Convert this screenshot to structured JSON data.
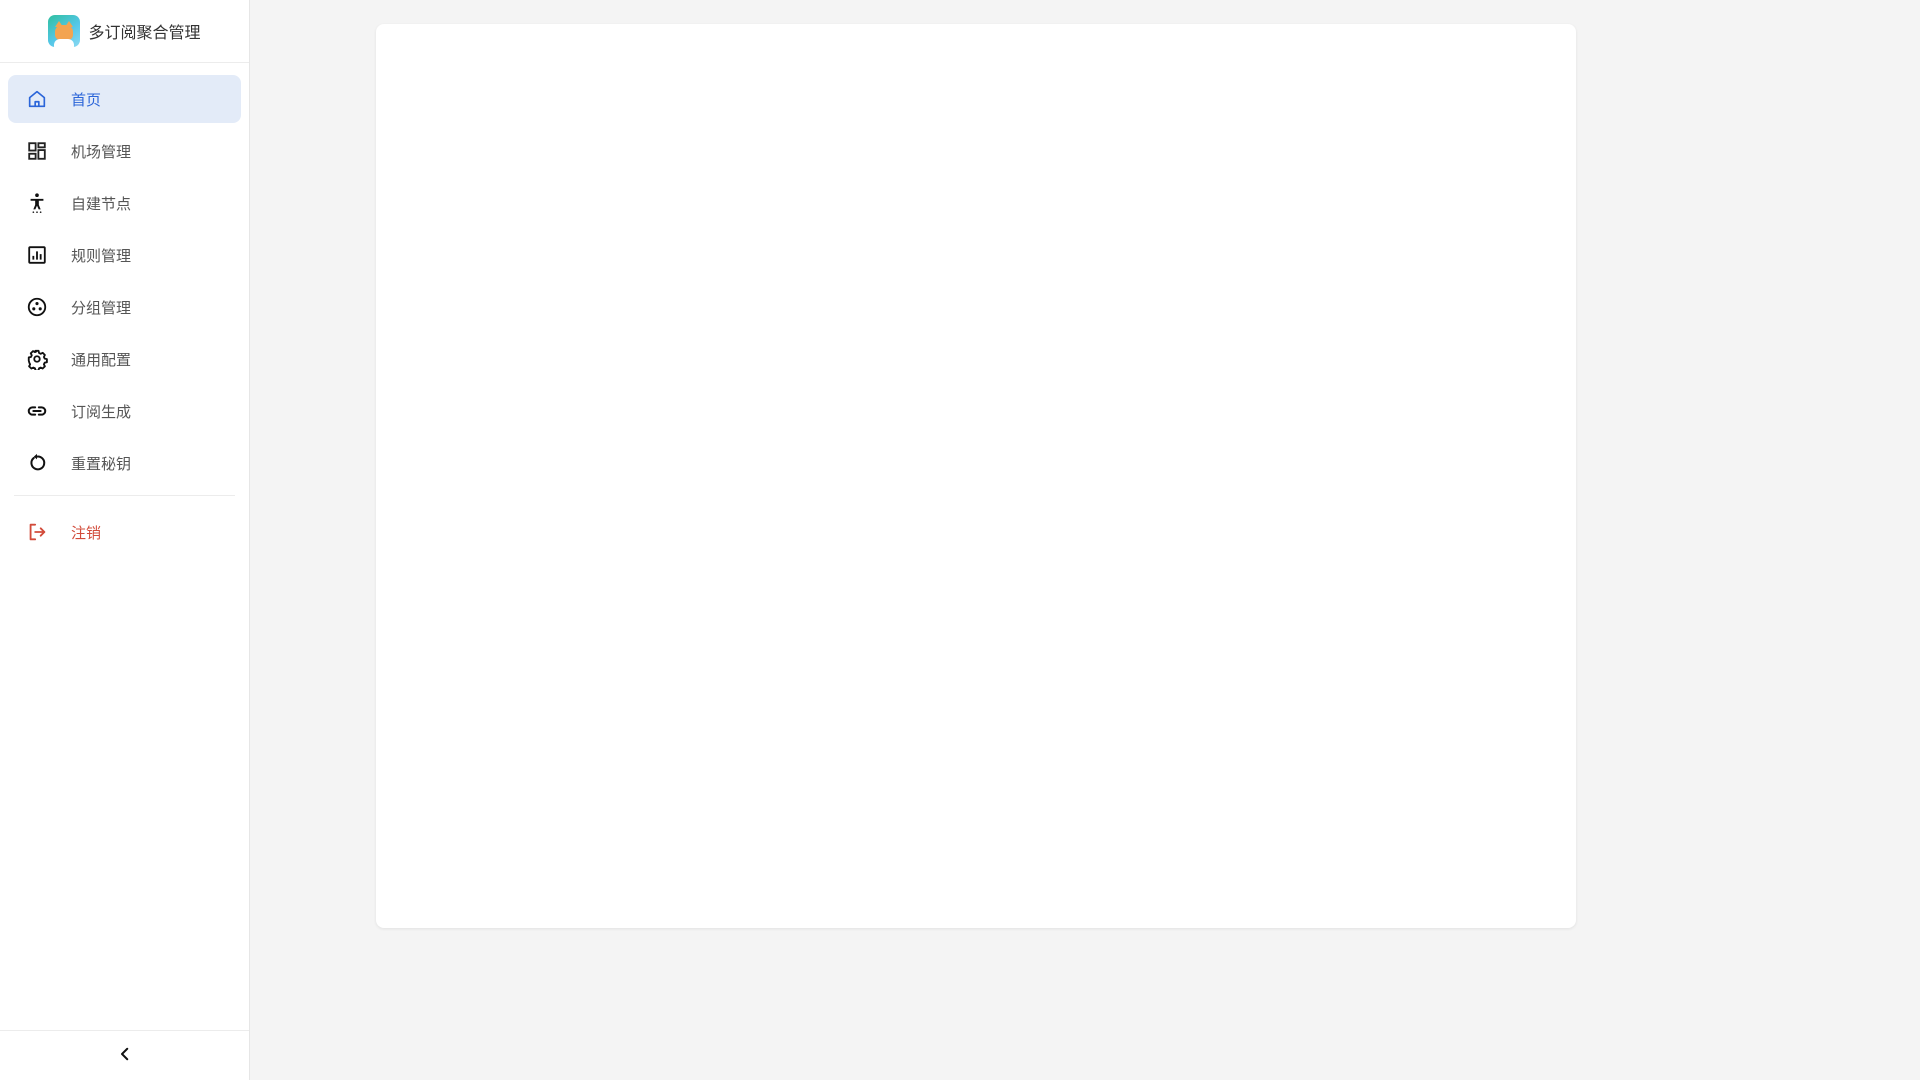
{
  "brand": {
    "title": "多订阅聚合管理",
    "logo_icon": "cat-avatar-logo"
  },
  "menu": {
    "items": [
      {
        "label": "首页",
        "icon": "home-icon",
        "active": true
      },
      {
        "label": "机场管理",
        "icon": "dashboard-grid-icon"
      },
      {
        "label": "自建节点",
        "icon": "accessibility-person-icon"
      },
      {
        "label": "规则管理",
        "icon": "bar-chart-icon"
      },
      {
        "label": "分组管理",
        "icon": "workspaces-circle-icon"
      },
      {
        "label": "通用配置",
        "icon": "gear-icon"
      },
      {
        "label": "订阅生成",
        "icon": "link-icon"
      },
      {
        "label": "重置秘钥",
        "icon": "refresh-icon"
      }
    ],
    "logout": {
      "label": "注销",
      "icon": "logout-icon"
    }
  },
  "footer": {
    "collapse_icon": "chevron-left-icon"
  },
  "colors": {
    "accent": "#2b65d9",
    "active_bg": "#e3ebf8",
    "danger": "#d24b3a",
    "page_bg": "#f4f4f4"
  }
}
